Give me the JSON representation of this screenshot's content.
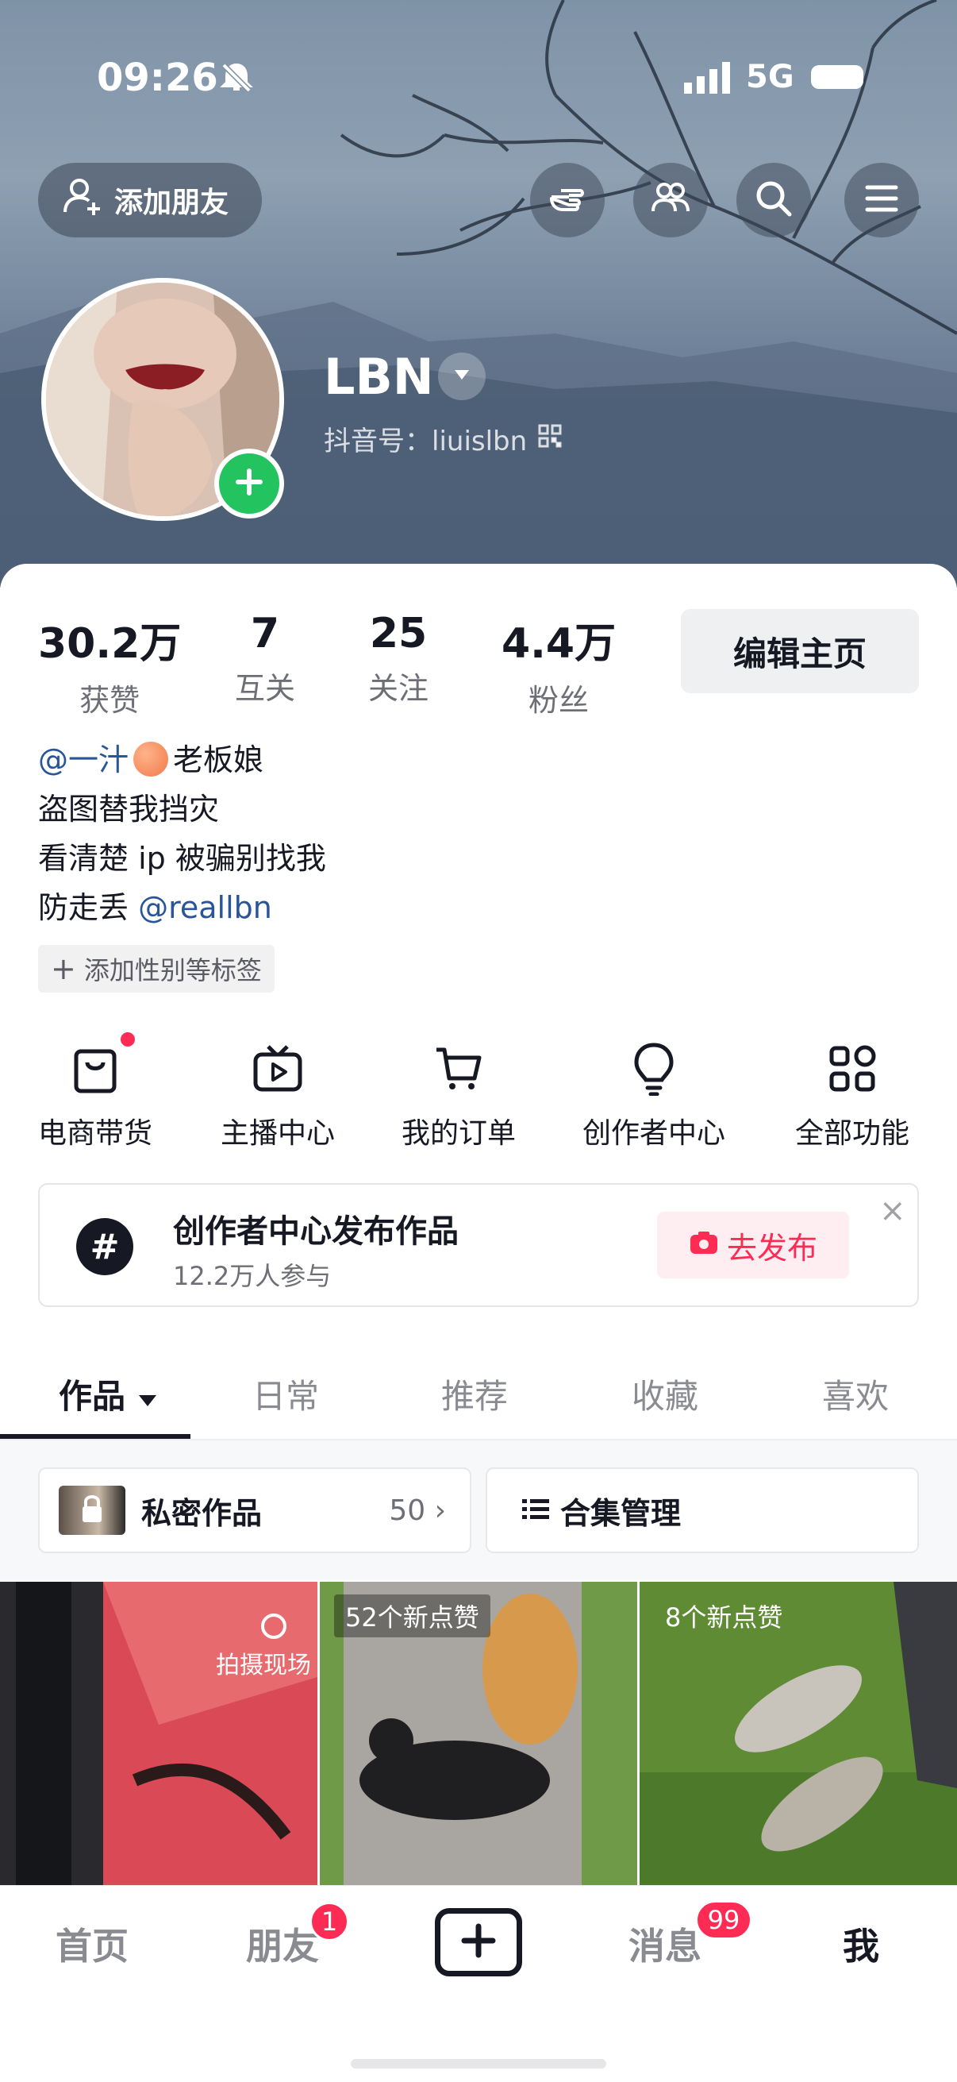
{
  "status_bar": {
    "time": "09:26",
    "network": "5G"
  },
  "header": {
    "add_friend_label": "添加朋友",
    "username": "LBN",
    "douyin_id": "抖音号：liuislbn"
  },
  "stats": [
    {
      "num": "30.2万",
      "label": "获赞"
    },
    {
      "num": "7",
      "label": "互关"
    },
    {
      "num": "25",
      "label": "关注"
    },
    {
      "num": "4.4万",
      "label": "粉丝"
    }
  ],
  "edit_profile_label": "编辑主页",
  "bio": {
    "line1_link": "@一汁",
    "line1_text": "老板娘",
    "line2": "盗图替我挡灾",
    "line3": "看清楚 ip 被骗别找我",
    "line4_text": "防走丢 ",
    "line4_link": "@reallbn"
  },
  "tag_button_label": "添加性别等标签",
  "features": [
    {
      "label": "电商带货",
      "icon": "shopping-bag-icon"
    },
    {
      "label": "主播中心",
      "icon": "tv-play-icon"
    },
    {
      "label": "我的订单",
      "icon": "cart-icon"
    },
    {
      "label": "创作者中心",
      "icon": "lightbulb-icon"
    },
    {
      "label": "全部功能",
      "icon": "grid-icon"
    }
  ],
  "promo": {
    "title": "创作者中心发布作品",
    "subtitle": "12.2万人参与",
    "button_label": "去发布"
  },
  "tabs": [
    "作品",
    "日常",
    "推荐",
    "收藏",
    "喜欢"
  ],
  "private_works": {
    "label": "私密作品",
    "count": "50"
  },
  "collection_label": "合集管理",
  "thumbnails": [
    {
      "badge": "拍摄现场"
    },
    {
      "badge": "52个新点赞"
    },
    {
      "badge": "8个新点赞"
    }
  ],
  "bottom_nav": {
    "home": "首页",
    "friends": "朋友",
    "friends_badge": "1",
    "messages": "消息",
    "messages_badge": "99",
    "me": "我"
  },
  "colors": {
    "accent": "#fe2c55",
    "link": "#2a5599",
    "green": "#23c45f"
  }
}
